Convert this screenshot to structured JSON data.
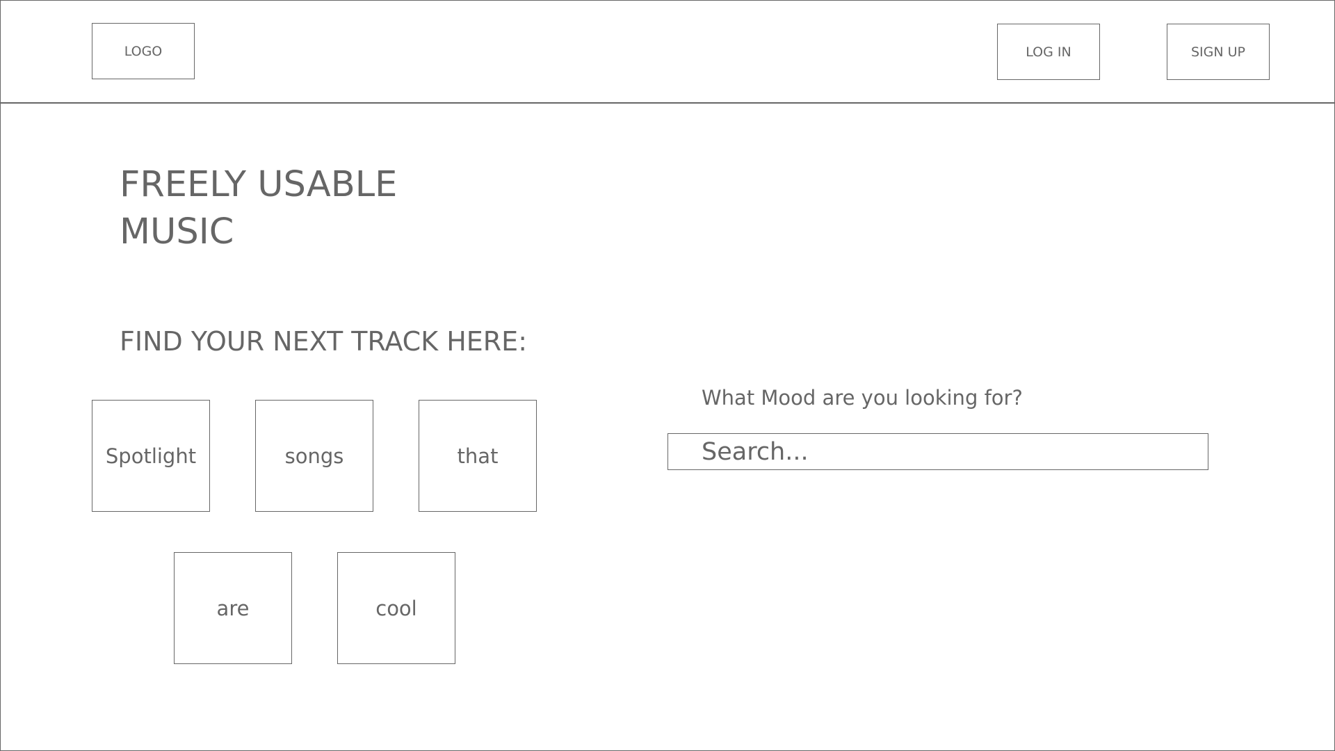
{
  "header": {
    "logo_label": "LOGO",
    "login_label": "LOG IN",
    "signup_label": "SIGN UP"
  },
  "hero": {
    "title_line1": "FREELY USABLE",
    "title_line2": "MUSIC",
    "subtitle": "FIND YOUR NEXT TRACK HERE:"
  },
  "tiles": [
    {
      "label": "Spotlight"
    },
    {
      "label": "songs"
    },
    {
      "label": "that"
    },
    {
      "label": "are"
    },
    {
      "label": "cool"
    }
  ],
  "search": {
    "label": "What Mood are you looking for?",
    "placeholder": "Search..."
  },
  "colors": {
    "line": "#666666",
    "text": "#666666",
    "background": "#ffffff"
  }
}
